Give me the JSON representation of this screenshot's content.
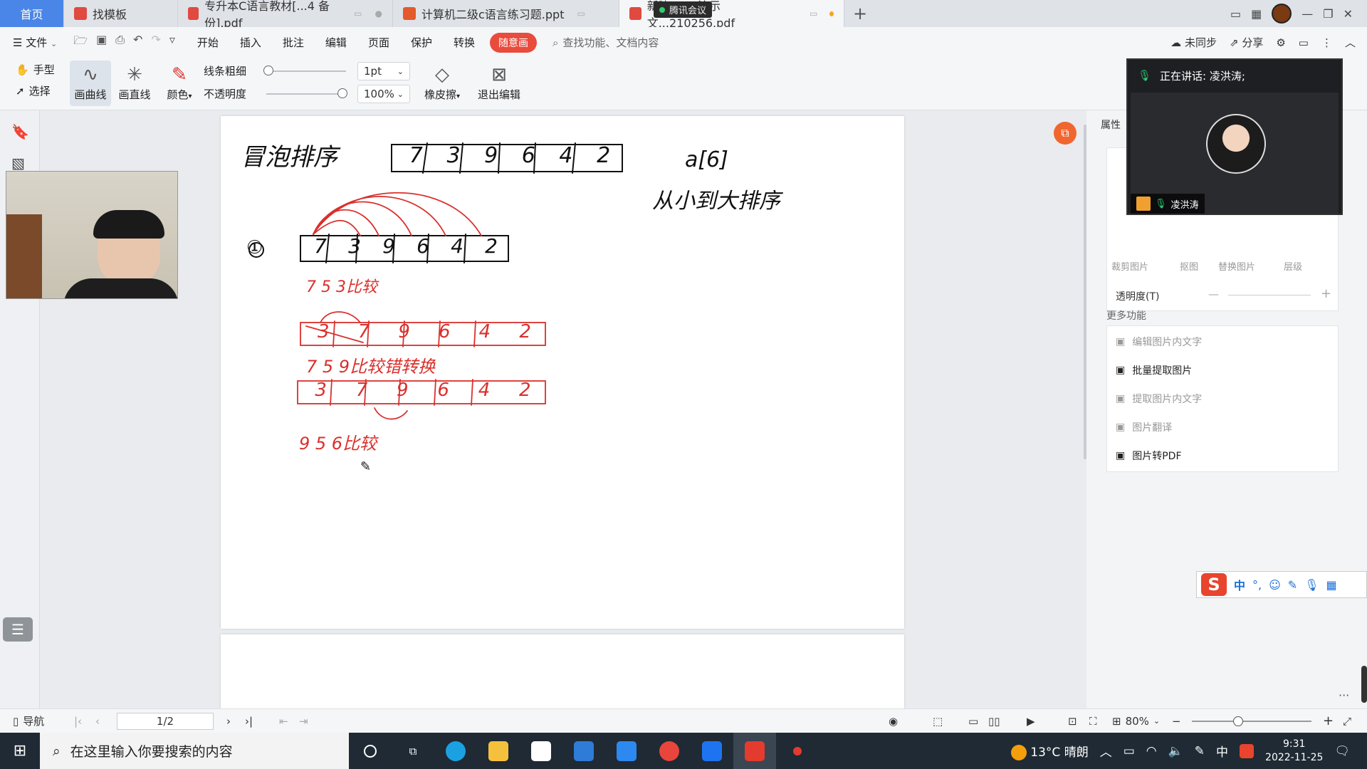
{
  "tabs": [
    {
      "label": "首页",
      "kind": "home"
    },
    {
      "label": "找模板",
      "kind": "template"
    },
    {
      "label": "专升本C语言教材[...4 备份].pdf",
      "kind": "pdf"
    },
    {
      "label": "计算机二级c语言练习题.ppt",
      "kind": "ppt"
    },
    {
      "label": "新建 PPT 演示文...210256.pdf",
      "kind": "pdf"
    }
  ],
  "meeting_float": "腾讯会议",
  "menu": {
    "file": "文件",
    "items": [
      "开始",
      "插入",
      "批注",
      "编辑",
      "页面",
      "保护",
      "转换"
    ],
    "highlight": "随意画",
    "search_placeholder": "查找功能、文档内容",
    "sync": "未同步",
    "share": "分享"
  },
  "ribbon": {
    "hand": "手型",
    "select": "选择",
    "curve": "画曲线",
    "straight": "画直线",
    "color": "颜色",
    "line_width_label": "线条粗细",
    "opacity_label": "不透明度",
    "line_width_value": "1pt",
    "opacity_value": "100%",
    "eraser": "橡皮擦",
    "exit_edit": "退出编辑"
  },
  "handwriting": {
    "title": "冒泡排序",
    "top_array": [
      "7",
      "3",
      "9",
      "6",
      "4",
      "2"
    ],
    "array_label": "a[6]",
    "note": "从小到大排序",
    "step_num": "①",
    "row1": [
      "7",
      "3",
      "9",
      "6",
      "4",
      "2"
    ],
    "line1": "7 5 3比较",
    "row2": [
      "3",
      "7",
      "9",
      "6",
      "4",
      "2"
    ],
    "line2": "7 5 9比较错转换",
    "row3": [
      "3",
      "7",
      "9",
      "6",
      "4",
      "2"
    ],
    "line3": "9 5 6比较"
  },
  "meeting": {
    "speaking": "正在讲话: 凌洪涛;",
    "name": "凌洪涛"
  },
  "right_panel": {
    "title": "属性",
    "tools": [
      "裁剪图片",
      "抠图",
      "替换图片",
      "层级"
    ],
    "opacity_label": "透明度(T)",
    "more_title": "更多功能",
    "functions": [
      {
        "label": "编辑图片内文字",
        "enabled": false
      },
      {
        "label": "批量提取图片",
        "enabled": true
      },
      {
        "label": "提取图片内文字",
        "enabled": false
      },
      {
        "label": "图片翻译",
        "enabled": false
      },
      {
        "label": "图片转PDF",
        "enabled": true
      }
    ]
  },
  "ime": {
    "mode": "中",
    "punct": "°,"
  },
  "status": {
    "nav": "导航",
    "page": "1/2",
    "zoom": "80%"
  },
  "taskbar": {
    "search_placeholder": "在这里输入你要搜索的内容",
    "weather": "13°C  晴朗",
    "ime_lang": "中",
    "time": "9:31",
    "date": "2022-11-25"
  },
  "colors": {
    "accent_red": "#e94b3c",
    "ink_black": "#111111",
    "ink_red": "#d9302c",
    "home_tab": "#4a86e8",
    "taskbar": "#1f2a34"
  }
}
